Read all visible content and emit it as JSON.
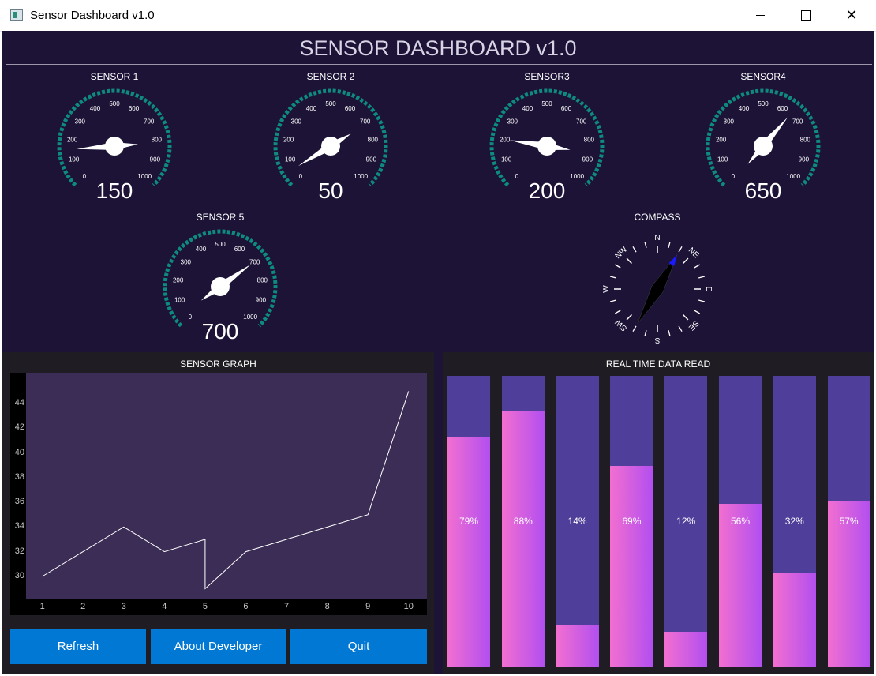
{
  "window": {
    "title": "Sensor Dashboard v1.0",
    "minimize": "minimize",
    "maximize": "maximize",
    "close": "close"
  },
  "header": {
    "title": "SENSOR DASHBOARD v1.0"
  },
  "gauges": [
    {
      "label": "SENSOR 1",
      "value": 150,
      "display": "150"
    },
    {
      "label": "SENSOR 2",
      "value": 50,
      "display": "50"
    },
    {
      "label": "SENSOR3",
      "value": 200,
      "display": "200"
    },
    {
      "label": "SENSOR4",
      "value": 650,
      "display": "650"
    },
    {
      "label": "SENSOR 5",
      "value": 700,
      "display": "700"
    }
  ],
  "gauge_scale": {
    "min": 0,
    "max": 1000,
    "ticks": [
      "0",
      "100",
      "200",
      "300",
      "400",
      "500",
      "600",
      "700",
      "800",
      "900",
      "1000"
    ],
    "accent": "#0e8a80"
  },
  "compass": {
    "label": "COMPASS",
    "heading_deg": 30,
    "points": [
      "N",
      "NE",
      "E",
      "SE",
      "S",
      "SW",
      "W",
      "NW"
    ],
    "needle_color": "#000000",
    "tip_color": "#1a1aff"
  },
  "graph": {
    "title": "SENSOR GRAPH",
    "chart_data": {
      "type": "line",
      "x": [
        1,
        2,
        3,
        4,
        5,
        5,
        6,
        7,
        8,
        9,
        10
      ],
      "y": [
        30,
        32,
        34,
        32,
        33,
        29,
        32,
        33,
        34,
        35,
        45
      ],
      "ylim": [
        28.2,
        46.5
      ],
      "xlim": [
        0.6,
        10.45
      ],
      "yticks": [
        "30",
        "32",
        "34",
        "36",
        "38",
        "40",
        "42",
        "44"
      ],
      "xticks": [
        "1",
        "2",
        "3",
        "4",
        "5",
        "6",
        "7",
        "8",
        "9",
        "10"
      ],
      "line_color": "#ffffff",
      "background": "#3b2d55"
    }
  },
  "realtime": {
    "title": "REAL TIME DATA READ",
    "bars": [
      {
        "value": 79,
        "label": "79%"
      },
      {
        "value": 88,
        "label": "88%"
      },
      {
        "value": 14,
        "label": "14%"
      },
      {
        "value": 69,
        "label": "69%"
      },
      {
        "value": 12,
        "label": "12%"
      },
      {
        "value": 56,
        "label": "56%"
      },
      {
        "value": 32,
        "label": "32%"
      },
      {
        "value": 57,
        "label": "57%"
      }
    ]
  },
  "buttons": {
    "refresh": "Refresh",
    "about": "About Developer",
    "quit": "Quit"
  }
}
